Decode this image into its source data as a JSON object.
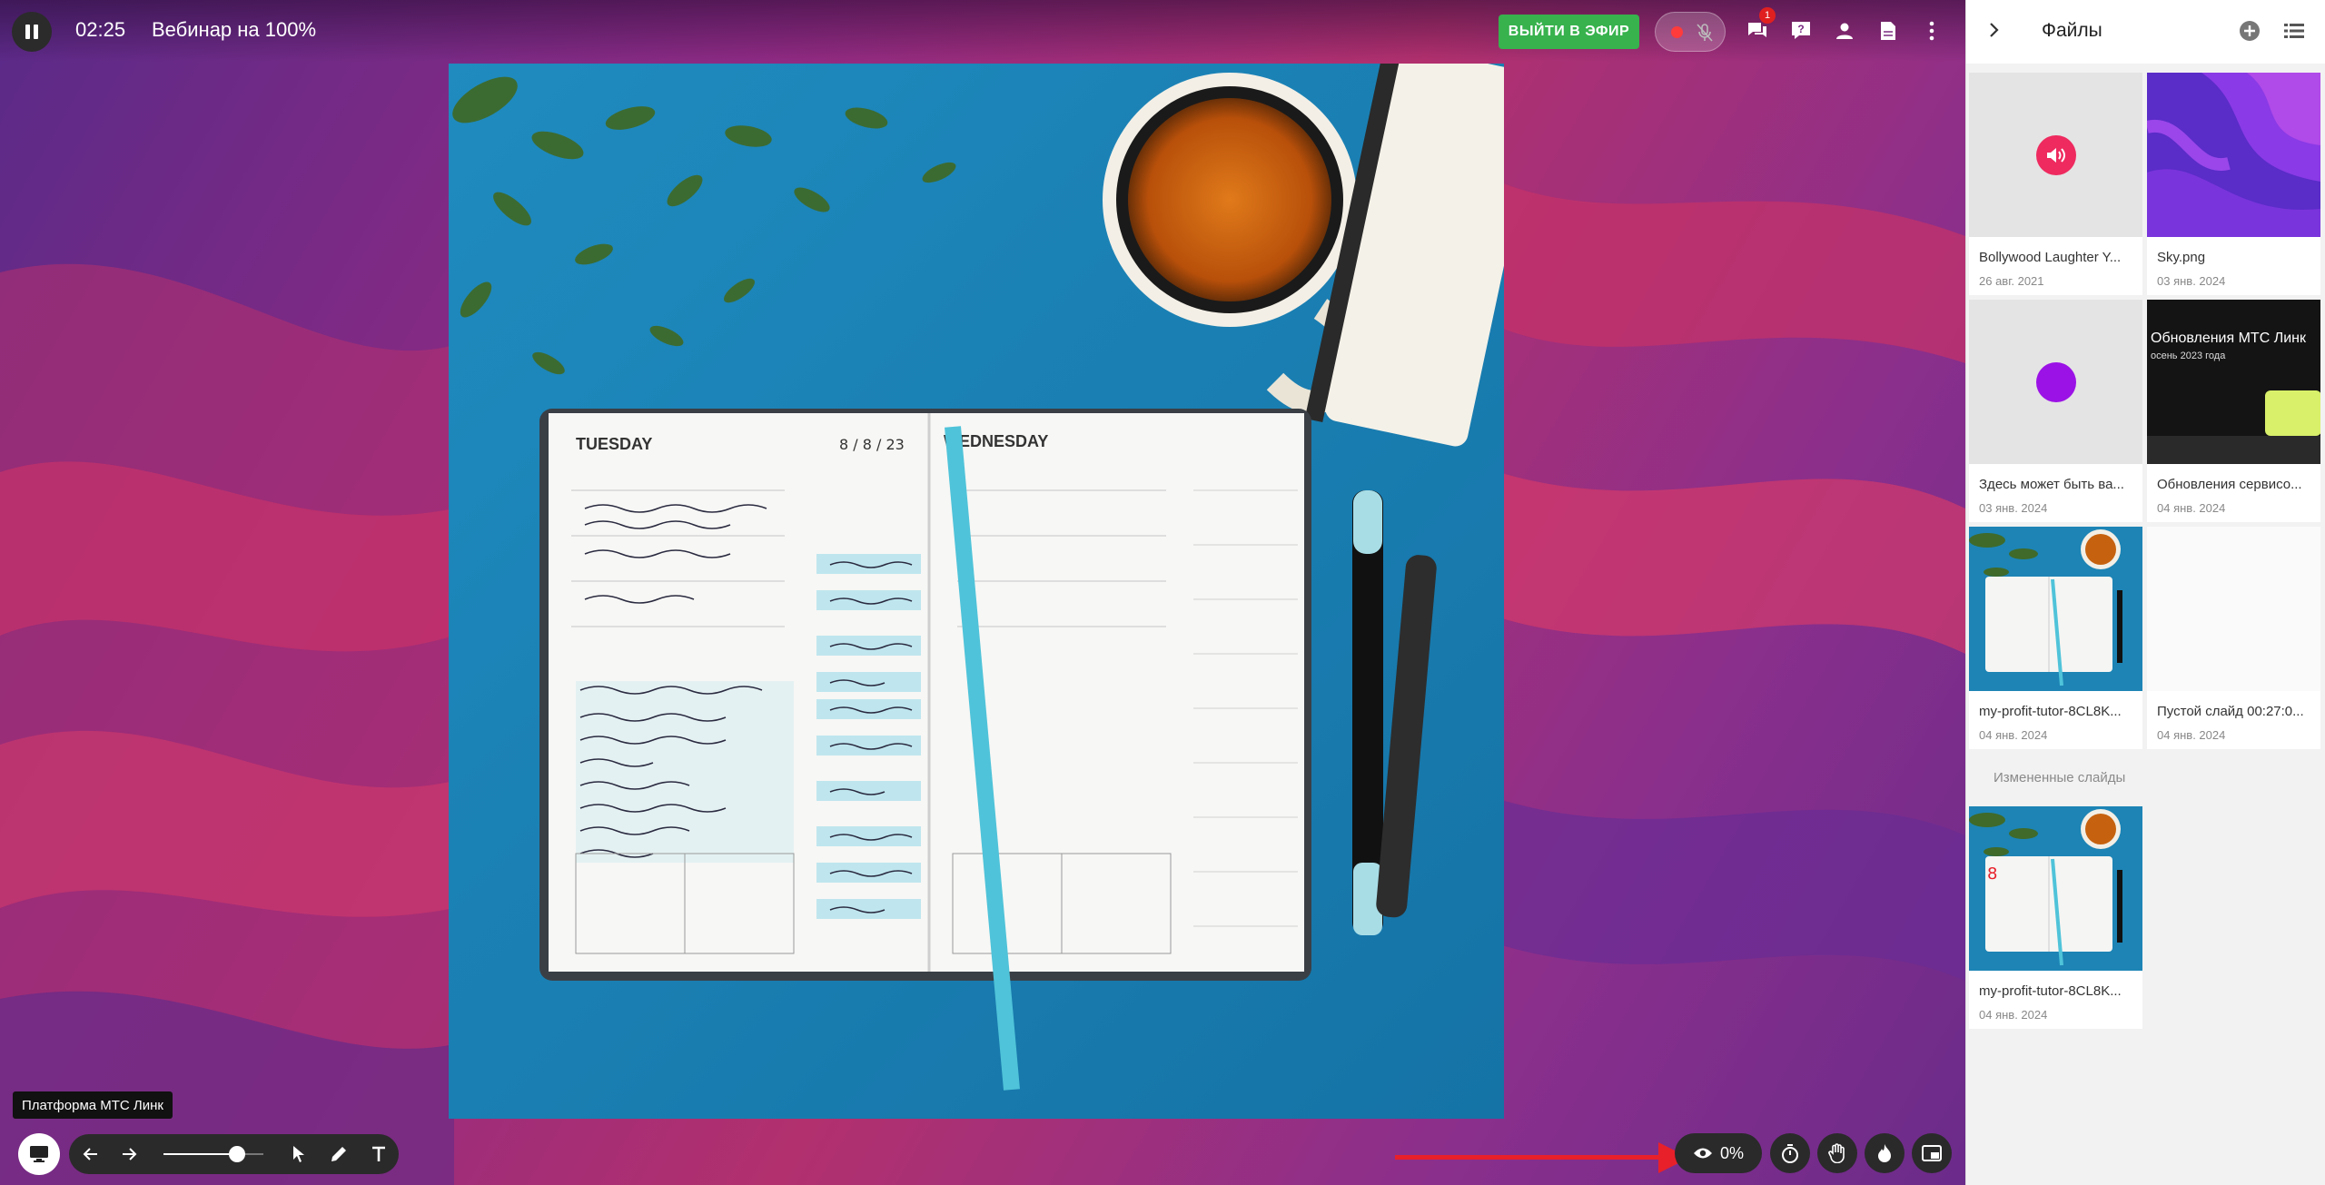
{
  "header": {
    "timer": "02:25",
    "title": "Вебинар на 100%",
    "go_live_label": "ВЫЙТИ В ЭФИР",
    "chat_badge": "1"
  },
  "icons": {
    "pause": "pause-icon",
    "record": "record-dot-icon",
    "mic": "mic-off-icon",
    "chat": "chat-icon",
    "help": "question-icon",
    "participants": "person-icon",
    "files": "document-icon",
    "more": "more-vert-icon"
  },
  "slide": {
    "planner_left_day": "TUESDAY",
    "planner_right_day": "WEDNESDAY",
    "planner_date": "8 / 8 / 23"
  },
  "bottom": {
    "tooltip": "Платформа МТС Линк",
    "views_percent": "0%",
    "zoom_level": 0.8
  },
  "files_panel": {
    "title": "Файлы",
    "section_changed": "Измененные слайды",
    "files": [
      {
        "name": "Bollywood Laughter Y...",
        "date": "26 авг. 2021",
        "kind": "audio"
      },
      {
        "name": "Sky.png",
        "date": "03 янв. 2024",
        "kind": "image"
      },
      {
        "name": "Здесь может быть ва...",
        "date": "03 янв. 2024",
        "kind": "video"
      },
      {
        "name": "Обновления сервисо...",
        "date": "04 янв. 2024",
        "kind": "presentation",
        "thumb_text": "Обновления МТС Линк",
        "thumb_sub": "осень 2023 года"
      },
      {
        "name": "my-profit-tutor-8CL8K...",
        "date": "04 янв. 2024",
        "kind": "photo"
      },
      {
        "name": "Пустой слайд 00:27:0...",
        "date": "04 янв. 2024",
        "kind": "blank"
      }
    ],
    "changed": [
      {
        "name": "my-profit-tutor-8CL8K...",
        "date": "04 янв. 2024",
        "kind": "photo"
      }
    ]
  },
  "colors": {
    "live_button": "#37b24d",
    "audio_icon": "#ee2a5f",
    "video_icon": "#9b12e6",
    "arrow": "#e8202a",
    "record_dot": "#ff3b3b"
  }
}
